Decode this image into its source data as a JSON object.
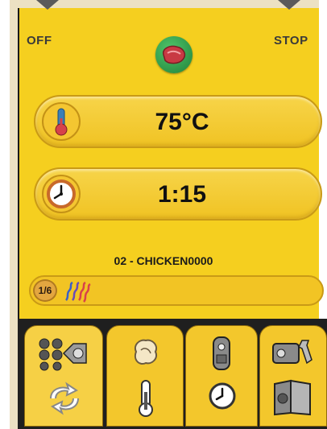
{
  "header": {
    "off_label": "OFF",
    "stop_label": "STOP",
    "center_icon": "meat-icon"
  },
  "temperature": {
    "value": "75°C",
    "icon": "thermometer-icon"
  },
  "time": {
    "value": "1:15",
    "icon": "clock-icon"
  },
  "program": {
    "name": "02 - CHICKEN0000"
  },
  "progress": {
    "step_label": "1/6",
    "icon": "heat-waves-icon"
  },
  "tabs": [
    {
      "name": "manual-mode-tab",
      "icons": [
        "fan-display-icon",
        "cycle-icon"
      ]
    },
    {
      "name": "core-probe-tab",
      "icons": [
        "chicken-icon",
        "thermometer-icon"
      ]
    },
    {
      "name": "delayed-cook-tab",
      "icons": [
        "probe-icon",
        "clock-icon"
      ]
    },
    {
      "name": "settings-tab",
      "icons": [
        "tools-icon",
        "book-icon"
      ]
    }
  ],
  "colors": {
    "panel": "#f5cf1f",
    "accent_green": "#2f9a49",
    "dark": "#1f1f1f"
  }
}
